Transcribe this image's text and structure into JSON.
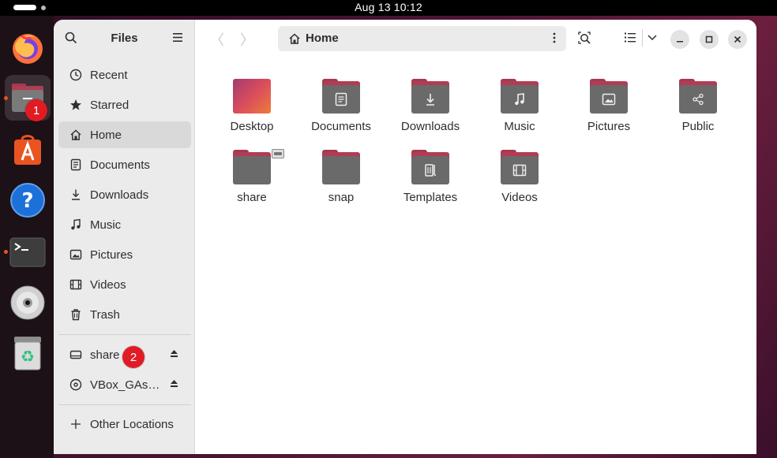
{
  "topbar": {
    "clock": "Aug 13  10:12"
  },
  "dock": {
    "items": [
      {
        "name": "firefox"
      },
      {
        "name": "files",
        "badge": "1"
      },
      {
        "name": "app-center"
      },
      {
        "name": "help"
      },
      {
        "name": "terminal"
      },
      {
        "name": "optical-disc"
      },
      {
        "name": "trash"
      }
    ]
  },
  "sidebar": {
    "title": "Files",
    "items": [
      {
        "label": "Recent",
        "icon": "clock-icon"
      },
      {
        "label": "Starred",
        "icon": "star-icon"
      },
      {
        "label": "Home",
        "icon": "home-icon"
      },
      {
        "label": "Documents",
        "icon": "document-icon"
      },
      {
        "label": "Downloads",
        "icon": "download-icon"
      },
      {
        "label": "Music",
        "icon": "music-note-icon"
      },
      {
        "label": "Pictures",
        "icon": "picture-icon"
      },
      {
        "label": "Videos",
        "icon": "film-icon"
      },
      {
        "label": "Trash",
        "icon": "trash-icon"
      }
    ],
    "devices": [
      {
        "label": "share",
        "icon": "drive-icon",
        "badge": "2"
      },
      {
        "label": "VBox_GAs…",
        "icon": "disc-icon"
      }
    ],
    "other_locations": "Other Locations"
  },
  "toolbar": {
    "path_label": "Home"
  },
  "files": [
    {
      "label": "Desktop"
    },
    {
      "label": "Documents"
    },
    {
      "label": "Downloads"
    },
    {
      "label": "Music"
    },
    {
      "label": "Pictures"
    },
    {
      "label": "Public"
    },
    {
      "label": "share"
    },
    {
      "label": "snap"
    },
    {
      "label": "Templates"
    },
    {
      "label": "Videos"
    }
  ],
  "colors": {
    "accent": "#e95420",
    "badge": "#e01b24",
    "folder_tab": "#b03c56",
    "folder_body": "#6a6a6a"
  }
}
